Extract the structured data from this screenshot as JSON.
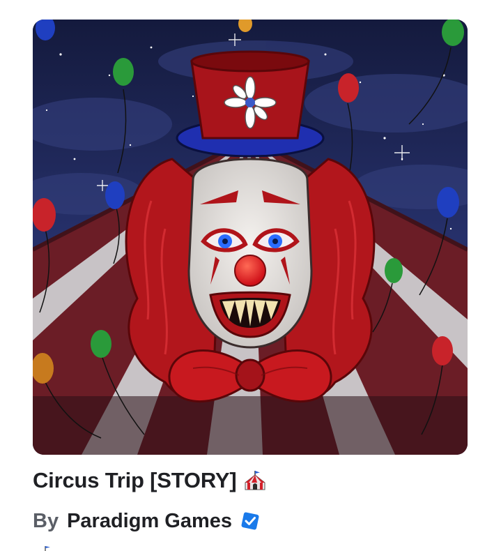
{
  "game": {
    "title": "Circus Trip [STORY]",
    "title_emoji": "circus-tent-icon",
    "thumbnail_icon": "creepy-clown-thumbnail",
    "by_label": "By",
    "creator_name": "Paradigm Games",
    "creator_verified_icon": "verified-badge-icon"
  },
  "colors": {
    "text_primary": "#1f2024",
    "text_secondary": "#5a5e66",
    "verified_blue": "#1a7aea",
    "thumbnail_sky": "#1b2145",
    "clown_red": "#c41a1f"
  }
}
